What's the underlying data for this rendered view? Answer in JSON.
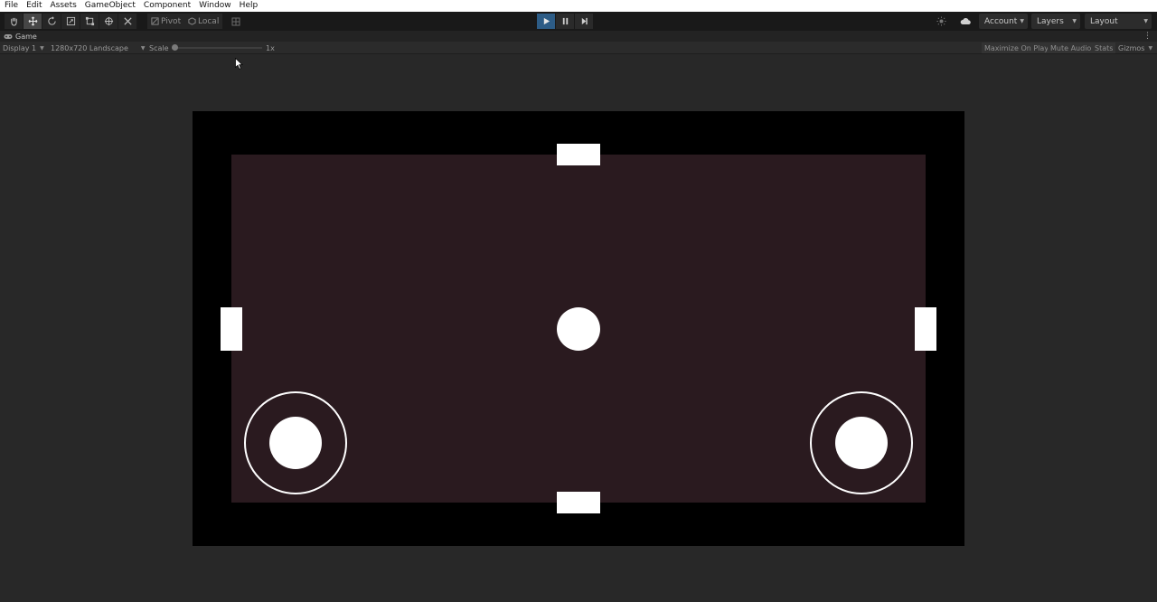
{
  "menubar": {
    "items": [
      "File",
      "Edit",
      "Assets",
      "GameObject",
      "Component",
      "Window",
      "Help"
    ]
  },
  "toolbar": {
    "tools": [
      {
        "name": "hand-tool-icon",
        "active": false
      },
      {
        "name": "move-tool-icon",
        "active": true
      },
      {
        "name": "rotate-tool-icon",
        "active": false
      },
      {
        "name": "scale-tool-icon",
        "active": false
      },
      {
        "name": "rect-tool-icon",
        "active": false
      },
      {
        "name": "transform-tool-icon",
        "active": false
      },
      {
        "name": "custom-tool-icon",
        "active": false
      }
    ],
    "pivot_label": "Pivot",
    "local_label": "Local",
    "account_label": "Account",
    "layers_label": "Layers",
    "layout_label": "Layout"
  },
  "tab": {
    "title": "Game"
  },
  "controls": {
    "display": "Display 1",
    "resolution": "1280x720 Landscape",
    "scale_label": "Scale",
    "scale_value": "1x",
    "maximize_on_play": "Maximize On Play",
    "mute_audio": "Mute Audio",
    "stats": "Stats",
    "gizmos": "Gizmos"
  },
  "colors": {
    "play_active": "#2d5c86",
    "field": "#2a1a1f",
    "letterbox": "#000000",
    "objects": "#ffffff"
  }
}
